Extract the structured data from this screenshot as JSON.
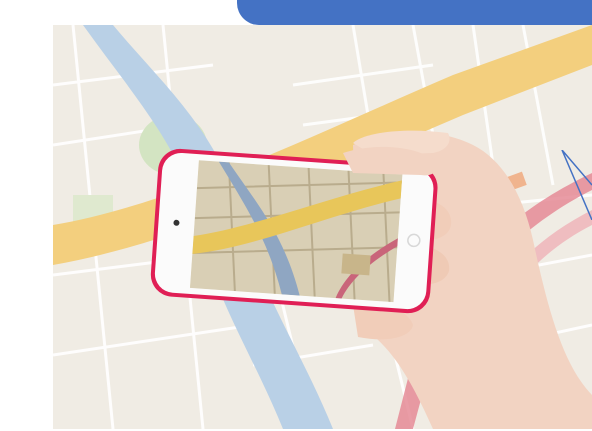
{
  "colors": {
    "banner": "#4472c4",
    "map_background": "#f0ece4",
    "river": "#b9d0e6",
    "main_road": "#f3cf7e",
    "secondary_road": "#e58b97",
    "park": "#d3e4c2",
    "phone_case": "#e01f55",
    "phone_screen_bezel": "#fbfbfb",
    "hand_skin": "#f2d3c2"
  },
  "icons": {
    "pointer": "callout-pointer-icon"
  }
}
